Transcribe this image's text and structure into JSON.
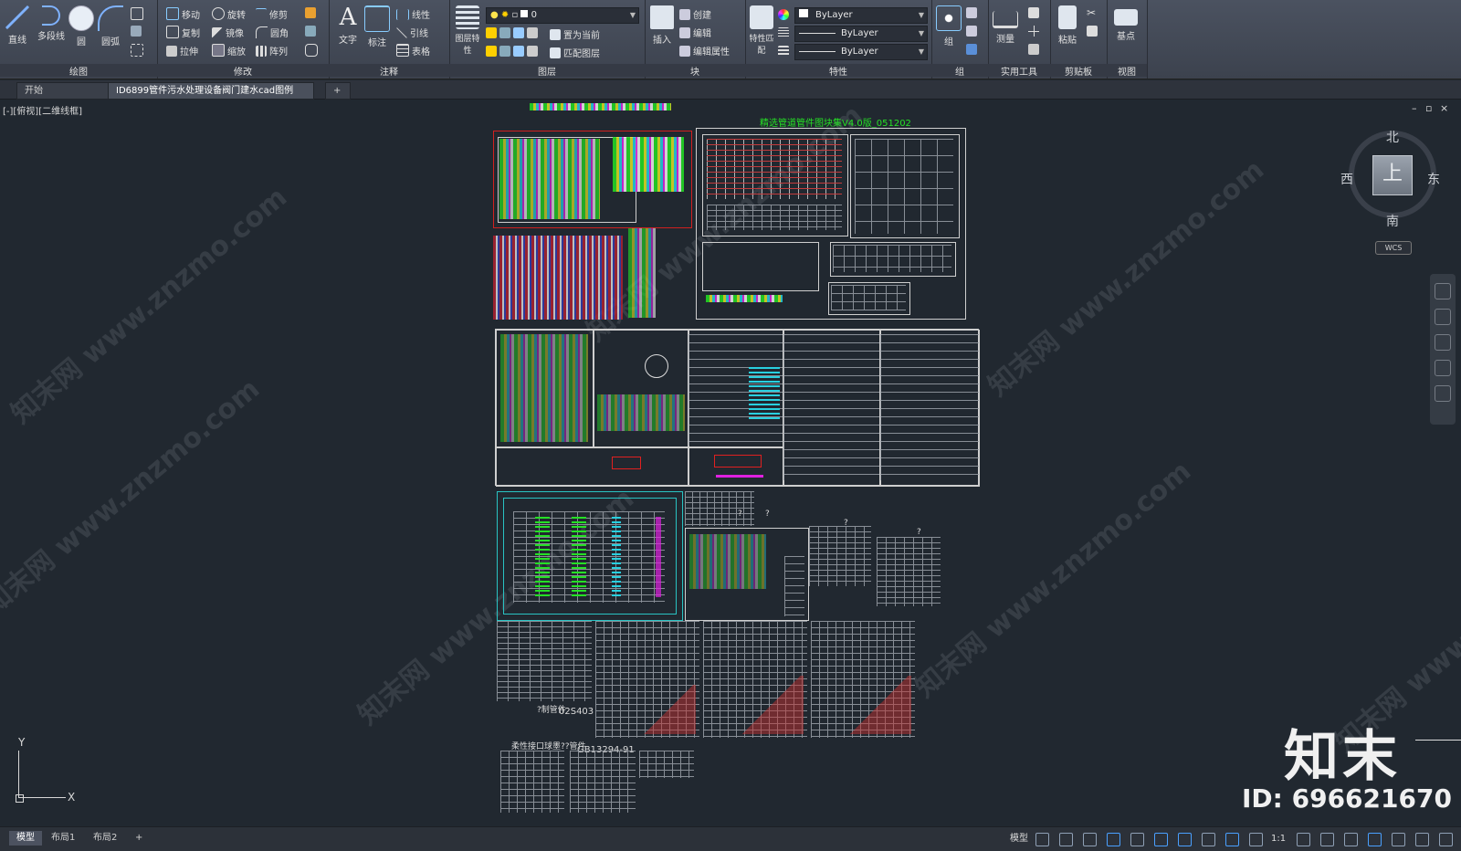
{
  "ribbon": {
    "draw": {
      "title": "绘图",
      "tools": [
        "直线",
        "多段线",
        "圆",
        "圆弧"
      ]
    },
    "modify": {
      "title": "修改",
      "tools": [
        "移动",
        "旋转",
        "修剪",
        "复制",
        "镜像",
        "圆角",
        "拉伸",
        "缩放",
        "阵列"
      ]
    },
    "annotate": {
      "title": "注释",
      "text": "文字",
      "dim": "标注",
      "linear": "线性",
      "leader": "引线",
      "table": "表格"
    },
    "layers": {
      "title": "图层",
      "layer_props": "图层特性",
      "layer_current": "0",
      "set_current": "置为当前",
      "match_layer": "匹配图层"
    },
    "block": {
      "title": "块",
      "insert": "插入",
      "create": "创建",
      "edit": "编辑",
      "edit_attr": "编辑属性"
    },
    "properties": {
      "title": "特性",
      "match": "特性匹配",
      "color": "ByLayer",
      "linetype": "ByLayer",
      "lineweight": "ByLayer"
    },
    "groups": {
      "title": "组",
      "group": "组"
    },
    "utilities": {
      "title": "实用工具",
      "measure": "测量"
    },
    "clipboard": {
      "title": "剪贴板",
      "paste": "粘贴"
    },
    "view": {
      "title": "视图",
      "base": "基点"
    }
  },
  "tabs": {
    "start": "开始",
    "file": "ID6899管件污水处理设备阀门建水cad图例*",
    "new": "+"
  },
  "viewport": {
    "label": "[-][俯视][二维线框]",
    "drawing_title": "精选管道管件图块集V4.0版_051202",
    "labels": {
      "std1": "?制管件",
      "std1_code": "02S403",
      "std2": "柔性接口球墨??管件",
      "std2_code": "GB13294-91",
      "q": "?"
    }
  },
  "viewcube": {
    "top": "上",
    "north": "北",
    "south": "南",
    "east": "东",
    "west": "西",
    "wcs": "WCS"
  },
  "ucs": {
    "x": "X",
    "y": "Y"
  },
  "watermark": {
    "site": "知末网 www.znzmo.com",
    "brand": "知末",
    "id": "ID: 696621670"
  },
  "bottom": {
    "tabs": [
      "模型",
      "布局1",
      "布局2"
    ],
    "add": "+",
    "model": "模型",
    "scale": "1:1"
  }
}
